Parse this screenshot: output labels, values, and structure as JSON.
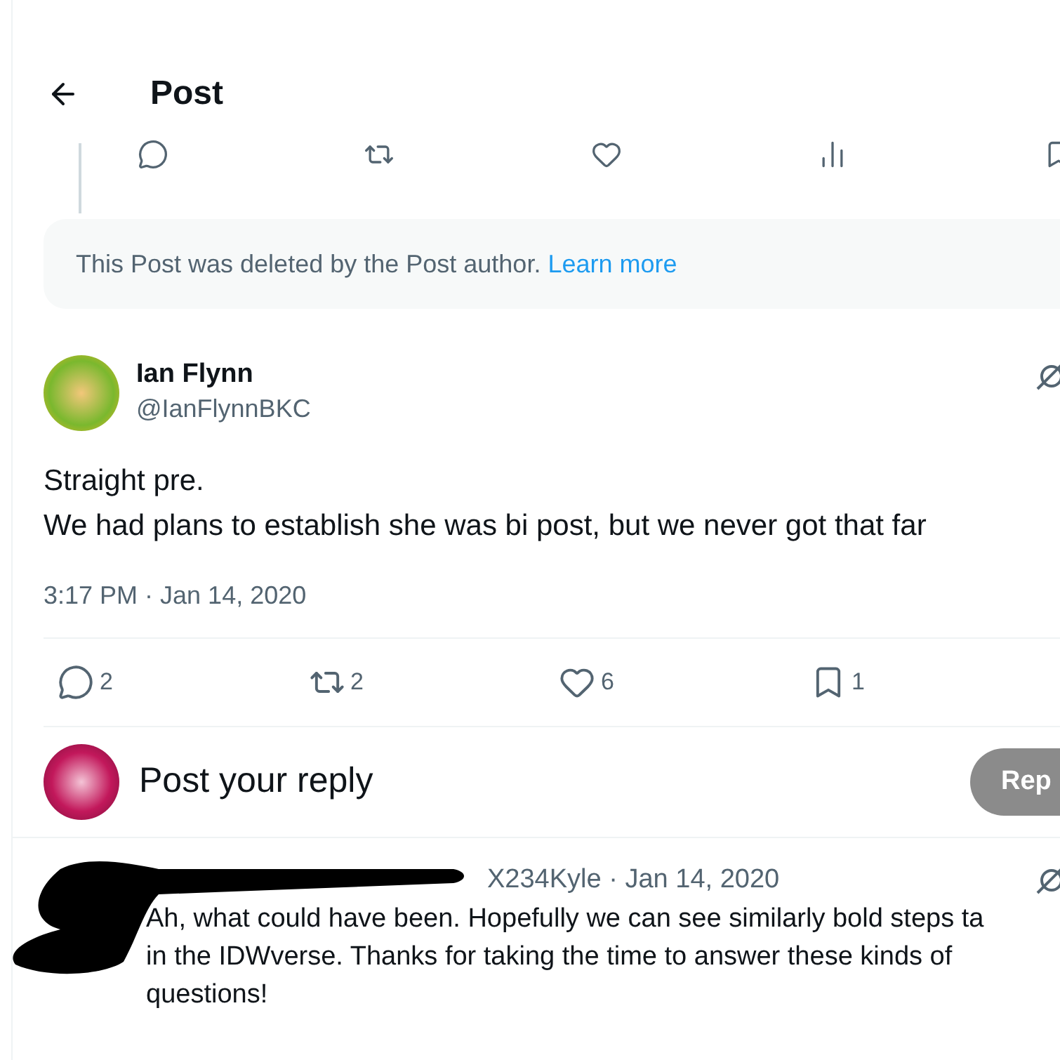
{
  "header": {
    "title": "Post"
  },
  "parent_actions": [
    {
      "kind": "reply"
    },
    {
      "kind": "repost"
    },
    {
      "kind": "like"
    },
    {
      "kind": "views"
    },
    {
      "kind": "bookmark"
    }
  ],
  "deleted_notice": {
    "text": "This Post was deleted by the Post author.",
    "link": "Learn more"
  },
  "post": {
    "name": "Ian Flynn",
    "handle": "@IanFlynnBKC",
    "lines": [
      "Straight pre.",
      "We had plans to establish she was bi post, but we never got that far"
    ],
    "timestamp": "3:17 PM · Jan 14, 2020",
    "stats": [
      {
        "kind": "reply",
        "count": "2"
      },
      {
        "kind": "repost",
        "count": "2"
      },
      {
        "kind": "like",
        "count": "6"
      },
      {
        "kind": "bookmark",
        "count": "1"
      }
    ]
  },
  "composer": {
    "placeholder": "Post your reply",
    "button": "Rep"
  },
  "reply": {
    "meta": "X234Kyle · Jan 14, 2020",
    "lines": [
      "Ah, what could have been. Hopefully we can see similarly bold steps ta",
      "in the IDWverse. Thanks for taking the time to answer these kinds of",
      "questions!"
    ]
  }
}
